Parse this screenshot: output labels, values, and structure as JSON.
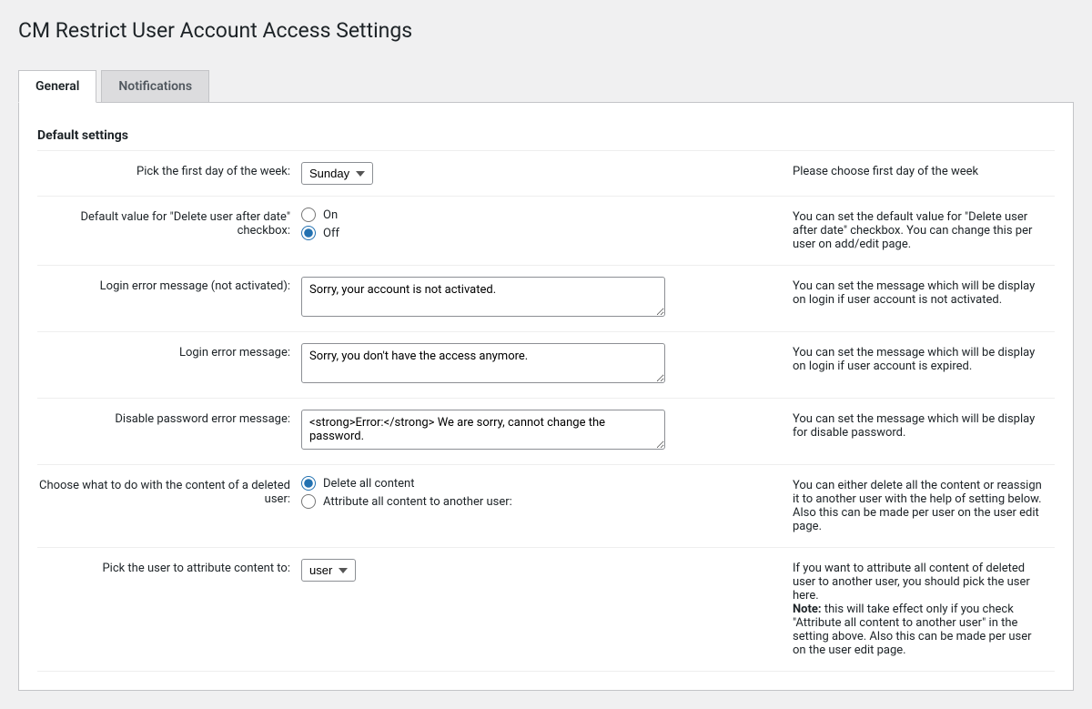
{
  "page_title": "CM Restrict User Account Access Settings",
  "tabs": {
    "general": "General",
    "notifications": "Notifications"
  },
  "section_heading": "Default settings",
  "rows": {
    "first_day": {
      "label": "Pick the first day of the week:",
      "value": "Sunday",
      "desc": "Please choose first day of the week"
    },
    "delete_default": {
      "label": "Default value for \"Delete user after date\" checkbox:",
      "opt_on": "On",
      "opt_off": "Off",
      "desc": "You can set the default value for \"Delete user after date\" checkbox. You can change this per user on add/edit page."
    },
    "login_not_activated": {
      "label": "Login error message (not activated):",
      "value": "Sorry, your account is not activated.",
      "desc": "You can set the message which will be display on login if user account is not activated."
    },
    "login_expired": {
      "label": "Login error message:",
      "value": "Sorry, you don't have the access anymore.",
      "desc": "You can set the message which will be display on login if user account is expired."
    },
    "disable_pw": {
      "label": "Disable password error message:",
      "value": "<strong>Error:</strong> We are sorry, cannot change the password.",
      "desc": "You can set the message which will be display for disable password."
    },
    "deleted_content": {
      "label": "Choose what to do with the content of a deleted user:",
      "opt_delete": "Delete all content",
      "opt_attribute": "Attribute all content to another user:",
      "desc": "You can either delete all the content or reassign it to another user with the help of setting below. Also this can be made per user on the user edit page."
    },
    "attribute_user": {
      "label": "Pick the user to attribute content to:",
      "value": "user",
      "desc_pre": "If you want to attribute all content of deleted user to another user, you should pick the user here.",
      "note_label": "Note:",
      "desc_post": " this will take effect only if you check \"Attribute all content to another user\" in the setting above. Also this can be made per user on the user edit page."
    }
  }
}
